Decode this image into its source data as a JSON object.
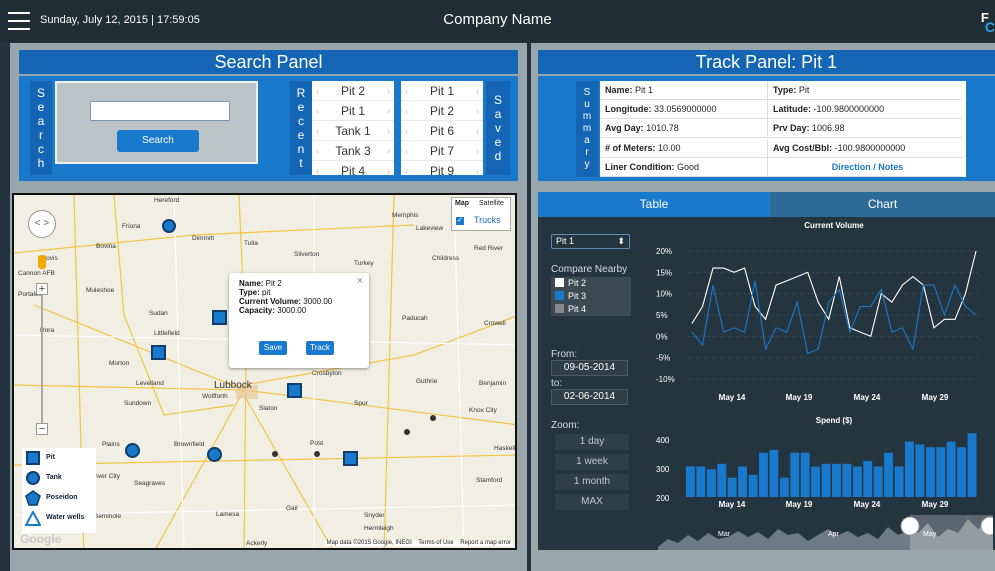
{
  "topbar": {
    "datetime": "Sunday, July 12, 2015 | 17:59:05",
    "company": "Company Name",
    "logo_letter_top": "F",
    "logo_letter_bottom": "C"
  },
  "search_panel": {
    "title": "Search Panel",
    "side_label": [
      "S",
      "e",
      "a",
      "r",
      "c",
      "h"
    ],
    "button": "Search",
    "recent_label": [
      "R",
      "e",
      "c",
      "e",
      "n",
      "t"
    ],
    "saved_label": [
      "S",
      "a",
      "v",
      "e",
      "d"
    ],
    "recent": [
      "Pit 2",
      "Pit 1",
      "Tank 1",
      "Tank 3",
      "Pit 4"
    ],
    "saved": [
      "Pit 1",
      "Pit 2",
      "Pit 6",
      "Pit 7",
      "Pit 9"
    ]
  },
  "map": {
    "type_map": "Map",
    "type_satellite": "Satellite",
    "trucks": "Trucks",
    "copyright": "Map data ©2015 Google, INEGI    Terms of Use    Report a map error",
    "google": "Google",
    "cities": [
      {
        "name": "Hereford"
      },
      {
        "name": "Friona"
      },
      {
        "name": "Dimmitt"
      },
      {
        "name": "Tulia"
      },
      {
        "name": "Silverton"
      },
      {
        "name": "Memphis"
      },
      {
        "name": "Lakeview"
      },
      {
        "name": "Bovina"
      },
      {
        "name": "Clovis"
      },
      {
        "name": "Cannon AFB"
      },
      {
        "name": "Portales"
      },
      {
        "name": "Muleshoe"
      },
      {
        "name": "Turkey"
      },
      {
        "name": "Childress"
      },
      {
        "name": "Red River"
      },
      {
        "name": "Sudan"
      },
      {
        "name": "Paducah"
      },
      {
        "name": "Crowell"
      },
      {
        "name": "Littlefield"
      },
      {
        "name": "Morton"
      },
      {
        "name": "Levelland"
      },
      {
        "name": "Lubbock"
      },
      {
        "name": "Crosbyton"
      },
      {
        "name": "Guthrie"
      },
      {
        "name": "Benjamin"
      },
      {
        "name": "Sundown"
      },
      {
        "name": "Wolfforth"
      },
      {
        "name": "Slaton"
      },
      {
        "name": "Spur"
      },
      {
        "name": "Knox City"
      },
      {
        "name": "Plains"
      },
      {
        "name": "Brownfield"
      },
      {
        "name": "Post"
      },
      {
        "name": "Haskell"
      },
      {
        "name": "Denver City"
      },
      {
        "name": "Seagraves"
      },
      {
        "name": "Stamford"
      },
      {
        "name": "Seminole"
      },
      {
        "name": "Lamesa"
      },
      {
        "name": "Gail"
      },
      {
        "name": "Snyder"
      },
      {
        "name": "Hermleigh"
      },
      {
        "name": "Ackerly"
      },
      {
        "name": "Dora"
      }
    ],
    "popup": {
      "name_k": "Name:",
      "name_v": " Pit 2",
      "type_k": "Type:",
      "type_v": " pit",
      "vol_k": "Current Volume:",
      "vol_v": " 3000.00",
      "cap_k": "Capacity:",
      "cap_v": " 3000.00",
      "save": "Save",
      "track": "Track",
      "close": "×"
    },
    "legend": [
      "Pit",
      "Tank",
      "Poseidon",
      "Water wells"
    ]
  },
  "track_panel": {
    "title": "Track Panel: Pit 1",
    "side_label": [
      "S",
      "u",
      "m",
      "m",
      "a",
      "r",
      "y"
    ],
    "rows": [
      [
        "Name:",
        " Pit 1",
        "Type:",
        " Pit"
      ],
      [
        "Longitude:",
        " 33.0569000000",
        "Latitude:",
        " -100.9800000000"
      ],
      [
        "Avg Day:",
        " 1010.78",
        "Prv Day:",
        " 1006.98"
      ],
      [
        "# of Meters:",
        " 10.00",
        "Avg Cost/Bbl:",
        " -100.9800000000"
      ],
      [
        "Liner Condition:",
        " Good",
        "Direction / Notes",
        ""
      ]
    ]
  },
  "tabs": {
    "table": "Table",
    "chart": "Chart"
  },
  "controls": {
    "select": "Pit 1",
    "select_arrow": "⬍",
    "compare": "Compare Nearby",
    "nearby": [
      {
        "label": "Pit 2",
        "color": "#ffffff"
      },
      {
        "label": "Pit 3",
        "color": "#1979cd"
      },
      {
        "label": "Pit 4",
        "color": "#888888"
      }
    ],
    "from": "From:",
    "from_v": "09-05-2014",
    "to": "to:",
    "to_v": "02-06-2014",
    "zoom": "Zoom:",
    "zoom_opts": [
      "1 day",
      "1 week",
      "1 month",
      "MAX"
    ]
  },
  "chart_data": [
    {
      "type": "line",
      "title": "Current Volume",
      "yticks": [
        "20%",
        "15%",
        "10%",
        "5%",
        "0%",
        "-5%",
        "-10%"
      ],
      "ylim": [
        -10,
        20
      ],
      "xticks": [
        "May 14",
        "May 19",
        "May 24",
        "May 29"
      ],
      "series": [
        {
          "values": [
            3,
            7,
            16,
            16,
            15,
            16,
            7,
            4,
            12,
            13,
            14,
            15,
            8,
            4,
            14,
            2,
            1,
            0,
            10,
            8,
            12,
            14,
            12,
            2,
            4,
            4,
            10,
            20
          ],
          "color": "#ffffff"
        },
        {
          "values": [
            1,
            -2,
            12,
            1,
            2,
            1,
            13,
            -3,
            2,
            1,
            8,
            -4,
            -3,
            8,
            11,
            1,
            7,
            7,
            11,
            1,
            2,
            -3,
            12,
            12,
            5,
            12,
            7,
            5
          ],
          "color": "#1979cd"
        }
      ]
    },
    {
      "type": "bar",
      "title": "Spend ($)",
      "yticks": [
        "400",
        "300",
        "200"
      ],
      "ylim": [
        170,
        430
      ],
      "xticks": [
        "May 14",
        "May 19",
        "May 24",
        "May 29"
      ],
      "values": [
        280,
        280,
        270,
        290,
        240,
        280,
        250,
        330,
        340,
        240,
        330,
        330,
        280,
        290,
        290,
        290,
        280,
        300,
        280,
        330,
        280,
        370,
        360,
        350,
        350,
        370,
        350,
        400
      ],
      "color": "#1979cd"
    },
    {
      "type": "area",
      "xticks": [
        "Mar",
        "Apr",
        "May"
      ]
    }
  ]
}
